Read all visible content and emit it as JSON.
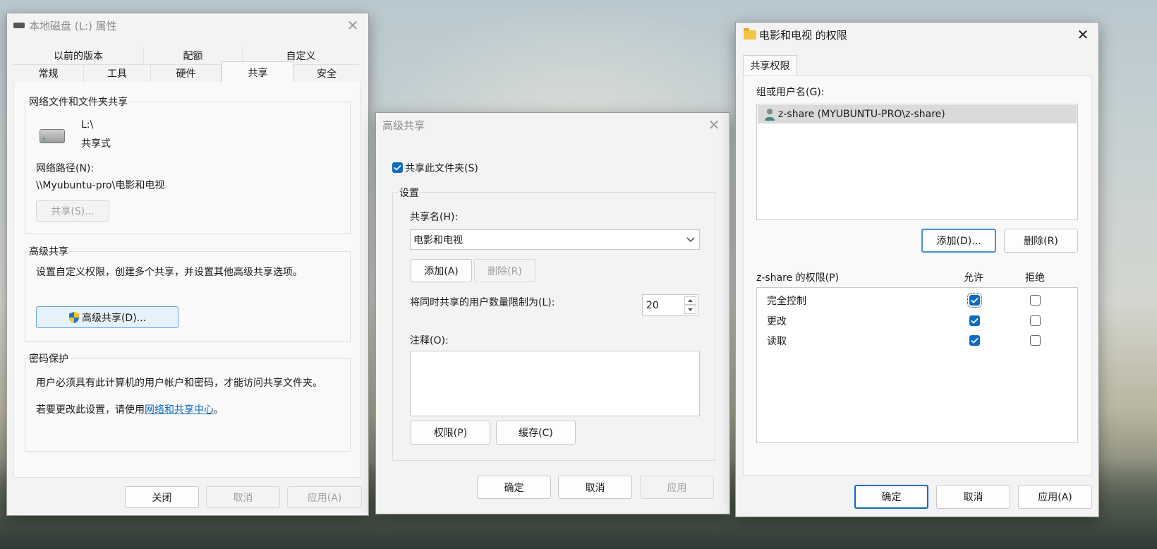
{
  "props_window": {
    "title": "本地磁盘 (L:) 属性",
    "tabs_row1": [
      "以前的版本",
      "配额",
      "自定义"
    ],
    "tabs_row2": [
      "常规",
      "工具",
      "硬件",
      "共享",
      "安全"
    ],
    "active_tab": "共享",
    "net_share": {
      "group_label": "网络文件和文件夹共享",
      "drive_name": "L:\\",
      "drive_status": "共享式",
      "path_label": "网络路径(N):",
      "path_value": "\\\\Myubuntu-pro\\电影和电视",
      "share_button": "共享(S)..."
    },
    "adv_share": {
      "group_label": "高级共享",
      "description": "设置自定义权限，创建多个共享，并设置其他高级共享选项。",
      "button": "高级共享(D)..."
    },
    "password": {
      "group_label": "密码保护",
      "text1": "用户必须具有此计算机的用户帐户和密码，才能访问共享文件夹。",
      "text2_prefix": "若要更改此设置，请使用",
      "link": "网络和共享中心",
      "text2_suffix": "。"
    },
    "buttons": {
      "close": "关闭",
      "cancel": "取消",
      "apply": "应用(A)"
    }
  },
  "adv_window": {
    "title": "高级共享",
    "share_checkbox": "共享此文件夹(S)",
    "share_checked": true,
    "settings_label": "设置",
    "share_name_label": "共享名(H):",
    "share_name_value": "电影和电视",
    "add_button": "添加(A)",
    "remove_button": "删除(R)",
    "limit_label": "将同时共享的用户数量限制为(L):",
    "limit_value": "20",
    "comment_label": "注释(O):",
    "permissions_button": "权限(P)",
    "cache_button": "缓存(C)",
    "buttons": {
      "ok": "确定",
      "cancel": "取消",
      "apply": "应用"
    }
  },
  "perm_window": {
    "title": "电影和电视 的权限",
    "tab": "共享权限",
    "group_users_label": "组或用户名(G):",
    "users": [
      "z-share (MYUBUNTU-PRO\\z-share)"
    ],
    "add_button": "添加(D)...",
    "remove_button": "删除(R)",
    "perm_label": "z-share 的权限(P)",
    "allow_label": "允许",
    "deny_label": "拒绝",
    "permissions": [
      {
        "name": "完全控制",
        "allow": true,
        "deny": false
      },
      {
        "name": "更改",
        "allow": true,
        "deny": false
      },
      {
        "name": "读取",
        "allow": true,
        "deny": false
      }
    ],
    "buttons": {
      "ok": "确定",
      "cancel": "取消",
      "apply": "应用(A)"
    }
  },
  "colors": {
    "accent": "#0f6cbd",
    "link": "#0f6cbd",
    "window_bg": "#f3f3f3"
  },
  "icons": {
    "drive": "hard-drive-icon",
    "shield": "uac-shield-icon",
    "folder": "folder-icon",
    "user": "user-icon"
  }
}
